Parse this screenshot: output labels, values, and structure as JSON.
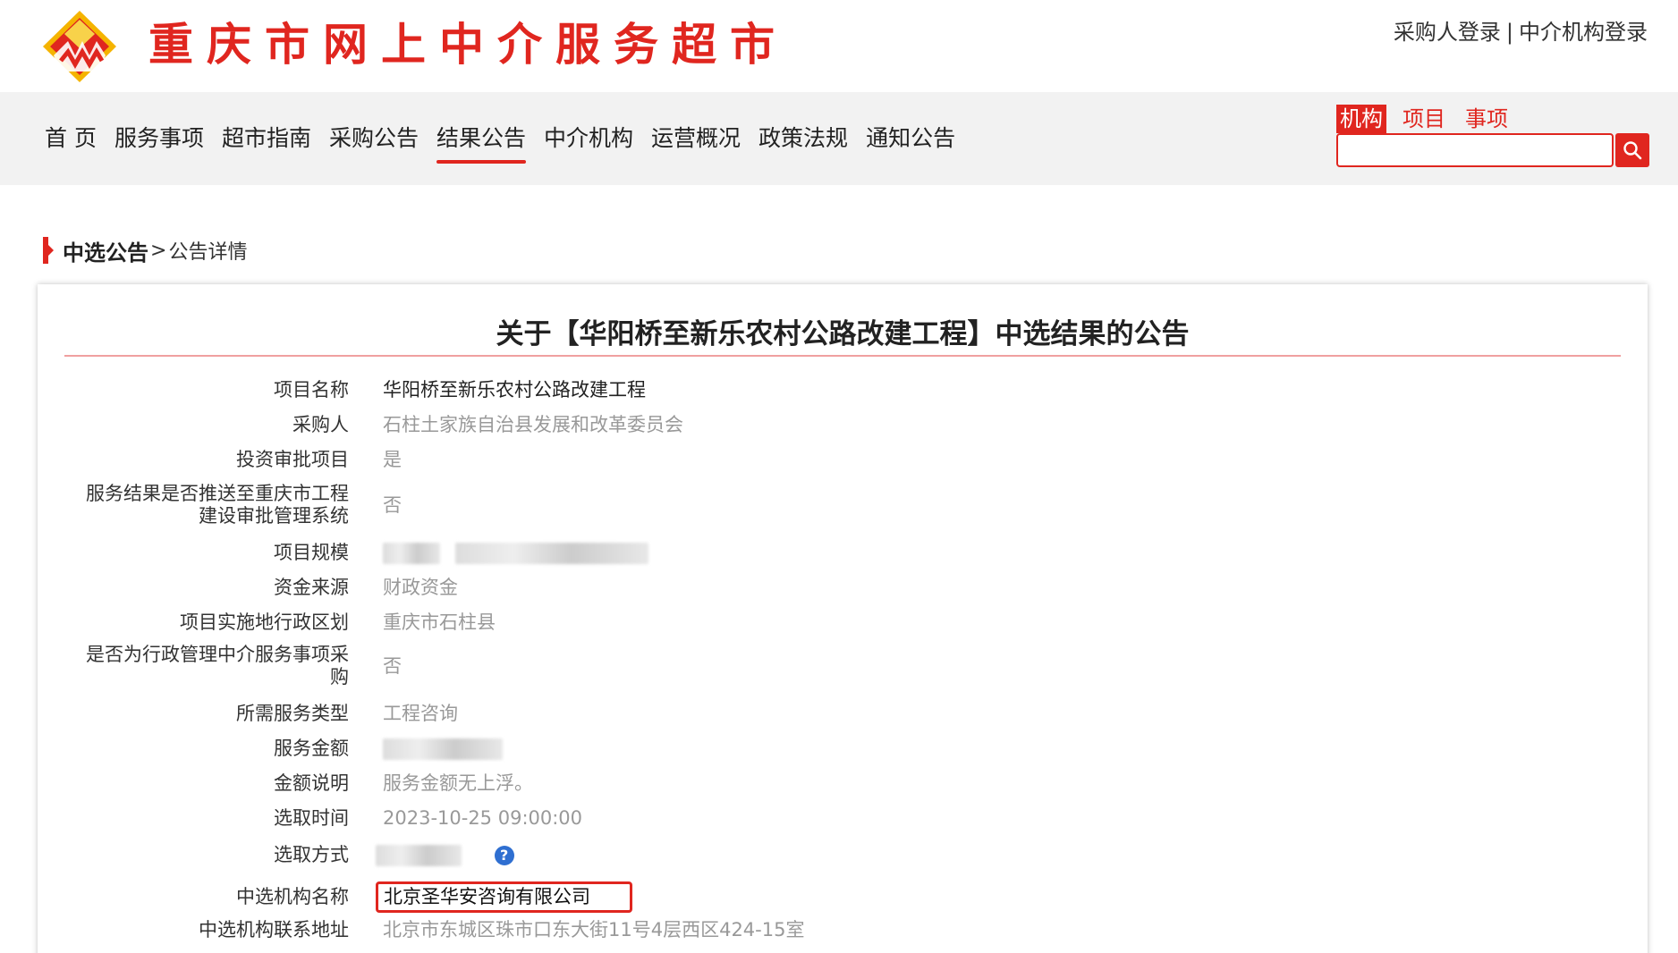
{
  "header": {
    "site_title": "重庆市网上中介服务超市",
    "login_buyer": "采购人登录",
    "login_separator": "|",
    "login_agency": "中介机构登录"
  },
  "nav": {
    "items": [
      "首 页",
      "服务事项",
      "超市指南",
      "采购公告",
      "结果公告",
      "中介机构",
      "运营概况",
      "政策法规",
      "通知公告"
    ],
    "active_index": 4
  },
  "search": {
    "tabs": [
      "机构",
      "项目",
      "事项"
    ],
    "active_tab": "机构",
    "value": ""
  },
  "breadcrumb": {
    "main": "中选公告",
    "separator": ">",
    "current": "公告详情"
  },
  "notice": {
    "title": "关于【华阳桥至新乐农村公路改建工程】中选结果的公告",
    "fields": [
      {
        "label": "项目名称",
        "value": "华阳桥至新乐农村公路改建工程"
      },
      {
        "label": "采购人",
        "value": "石柱土家族自治县发展和改革委员会"
      },
      {
        "label": "投资审批项目",
        "value": "是"
      },
      {
        "label_line1": "服务结果是否推送至重庆市工程",
        "label_line2": "建设审批管理系统",
        "value": "否"
      },
      {
        "label": "项目规模",
        "value": ""
      },
      {
        "label": "资金来源",
        "value": "财政资金"
      },
      {
        "label": "项目实施地行政区划",
        "value": "重庆市石柱县"
      },
      {
        "label_line1": "是否为行政管理中介服务事项采",
        "label_line2": "购",
        "value": "否"
      },
      {
        "label": "所需服务类型",
        "value": "工程咨询"
      },
      {
        "label": "服务金额",
        "value": ""
      },
      {
        "label": "金额说明",
        "value": "服务金额无上浮。"
      },
      {
        "label": "选取时间",
        "value": "2023-10-25 09:00:00"
      },
      {
        "label": "选取方式",
        "value": ""
      },
      {
        "label": "中选机构名称",
        "value": "北京圣华安咨询有限公司"
      },
      {
        "label": "中选机构联系地址",
        "value": "北京市东城区珠市口东大街11号4层西区424-15室"
      }
    ]
  },
  "colors": {
    "brand_red": "#e0261f",
    "nav_bg": "#f2f2f2",
    "value_gray": "#999999"
  }
}
